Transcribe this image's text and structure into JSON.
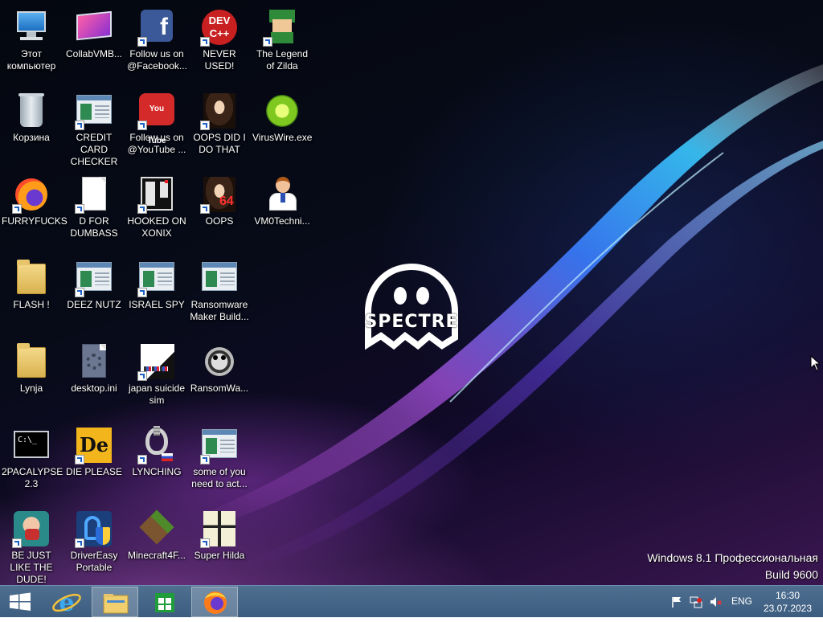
{
  "desktop": {
    "icons": [
      {
        "label": "Этот компьютер"
      },
      {
        "label": "CollabVMB..."
      },
      {
        "label": "Follow us on @Facebook..."
      },
      {
        "label": "NEVER USED!"
      },
      {
        "label": "The Legend of Zilda"
      },
      {
        "label": "Корзина"
      },
      {
        "label": "CREDIT CARD CHECKER"
      },
      {
        "label": "Follow us on @YouTube ..."
      },
      {
        "label": "OOPS DID I DO THAT"
      },
      {
        "label": "VirusWire.exe"
      },
      {
        "label": "FURRYFUCKS"
      },
      {
        "label": "D FOR DUMBASS"
      },
      {
        "label": "HOOKED ON XONIX"
      },
      {
        "label": "OOPS"
      },
      {
        "label": "VM0Techni..."
      },
      {
        "label": "FLASH !"
      },
      {
        "label": "DEEZ NUTZ"
      },
      {
        "label": "ISRAEL SPY"
      },
      {
        "label": "Ransomware Maker Build..."
      },
      {
        "label": "Lynja"
      },
      {
        "label": "desktop.ini"
      },
      {
        "label": "japan suicide sim"
      },
      {
        "label": "RansomWa..."
      },
      {
        "label": "2PACALYPSE 2.3"
      },
      {
        "label": "DIE PLEASE"
      },
      {
        "label": "LYNCHING"
      },
      {
        "label": "some of you need to act..."
      },
      {
        "label": "BE JUST LIKE THE DUDE!"
      },
      {
        "label": "DriverEasy Portable"
      },
      {
        "label": "Minecraft4F..."
      },
      {
        "label": "Super Hilda"
      }
    ],
    "icon_glyphs": {
      "dev": "DEV C++",
      "youtube": "You Tube",
      "six_four": "64",
      "die": "De",
      "cmd": "C:\\_"
    },
    "logo_text": "SPECTRE",
    "watermark_line1": "Windows 8.1 Профессиональная",
    "watermark_line2": "Build 9600"
  },
  "taskbar": {
    "language": "ENG",
    "time": "16:30",
    "date": "23.07.2023",
    "accent": "#4f6f91"
  }
}
